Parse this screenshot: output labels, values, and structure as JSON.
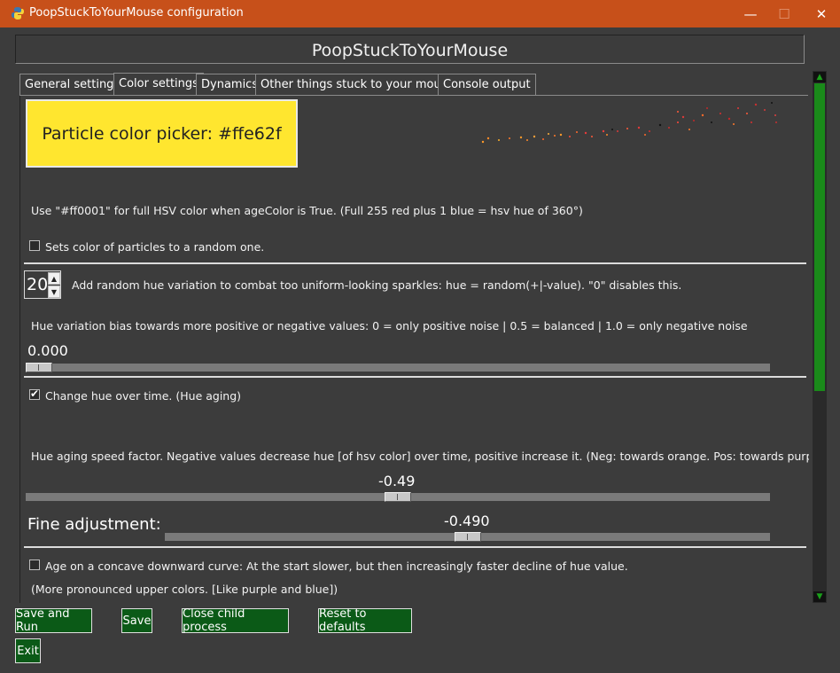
{
  "window": {
    "title": "PoopStuckToYourMouse configuration",
    "minimize": "—",
    "maximize": "☐",
    "close": "✕"
  },
  "header": {
    "title": "PoopStuckToYourMouse"
  },
  "tabs": [
    {
      "label": "General settings",
      "active": false
    },
    {
      "label": "Color settings",
      "active": true
    },
    {
      "label": "Dynamics",
      "active": false
    },
    {
      "label": "Other things stuck to your mouse",
      "active": false
    },
    {
      "label": "Console output",
      "active": false
    }
  ],
  "color_panel": {
    "picker_label": "Particle color picker: #ffe62f",
    "picker_color": "#ffe62f",
    "hsv_hint": "Use \"#ff0001\" for full HSV color when ageColor is True. (Full 255 red plus 1 blue = hsv hue of 360°)",
    "random_color_label": "Sets color of particles to a random one.",
    "random_color_checked": false,
    "hue_variation_value": "20",
    "hue_variation_label": "Add random hue variation to combat too uniform-looking sparkles: hue = random(+|-value). \"0\" disables this.",
    "hue_bias_label": "Hue variation bias towards more positive or negative values: 0 = only positive noise | 0.5 = balanced | 1.0 = only negative noise",
    "hue_bias_value": "0.000",
    "hue_bias_fraction": 0.0,
    "hue_aging_label": "Change hue over time. (Hue aging)",
    "hue_aging_checked": true,
    "aging_speed_label": "Hue aging speed factor. Negative values decrease hue [of hsv color] over time, positive increase it. (Neg: towards orange. Pos: towards purple)",
    "aging_speed_value": "-0.49",
    "aging_speed_fraction": 0.5,
    "fine_adjust_label": "Fine adjustment:",
    "fine_adjust_value": "-0.490",
    "fine_adjust_fraction": 0.5,
    "concave_label": "Age on a concave downward curve: At the start slower, but then increasingly faster decline of hue value.",
    "concave_checked": false,
    "concave_note": "(More pronounced upper colors. [Like purple and blue])"
  },
  "scrollbar": {
    "up": "▲",
    "down": "▼"
  },
  "buttons": {
    "save_and_run": "Save and Run",
    "save": "Save",
    "close_child": "Close child process",
    "reset": "Reset to defaults",
    "exit": "Exit"
  }
}
